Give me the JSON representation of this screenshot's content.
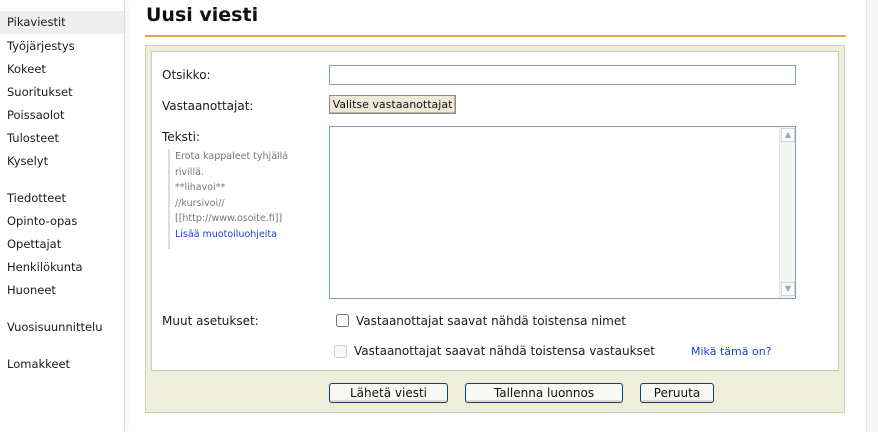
{
  "sidebar": {
    "items": [
      {
        "label": "Pikaviestit",
        "active": true
      },
      {
        "label": "Työjärjestys"
      },
      {
        "label": "Kokeet"
      },
      {
        "label": "Suoritukset"
      },
      {
        "label": "Poissaolot"
      },
      {
        "label": "Tulosteet"
      },
      {
        "label": "Kyselyt"
      },
      {
        "label": "Tiedotteet"
      },
      {
        "label": "Opinto-opas"
      },
      {
        "label": "Opettajat"
      },
      {
        "label": "Henkilökunta"
      },
      {
        "label": "Huoneet"
      },
      {
        "label": "Vuosisuunnittelu"
      },
      {
        "label": "Lomakkeet"
      }
    ]
  },
  "page": {
    "title": "Uusi viesti",
    "accent_color": "#d9a94a"
  },
  "form": {
    "subject_label": "Otsikko:",
    "subject_value": "",
    "recipients_label": "Vastaanottajat:",
    "recipients_button": "Valitse vastaanottajat",
    "text_label": "Teksti:",
    "text_value": "",
    "help": {
      "line1": "Erota kappaleet tyhjällä rivillä.",
      "bold": "**lihavoi**",
      "italic": "//kursivoi//",
      "link_syntax": "[[http://www.osoite.fi]]",
      "more_link": "Lisää muotoiluohjeita"
    },
    "other_settings_label": "Muut asetukset:",
    "options": [
      {
        "label": "Vastaanottajat saavat nähdä toistensa nimet",
        "checked": false,
        "enabled": true
      },
      {
        "label": "Vastaanottajat saavat nähdä toistensa vastaukset",
        "checked": false,
        "enabled": false
      }
    ],
    "whats_this": "Mikä tämä on?"
  },
  "actions": {
    "send": "Lähetä viesti",
    "save_draft": "Tallenna luonnos",
    "cancel": "Peruuta"
  }
}
